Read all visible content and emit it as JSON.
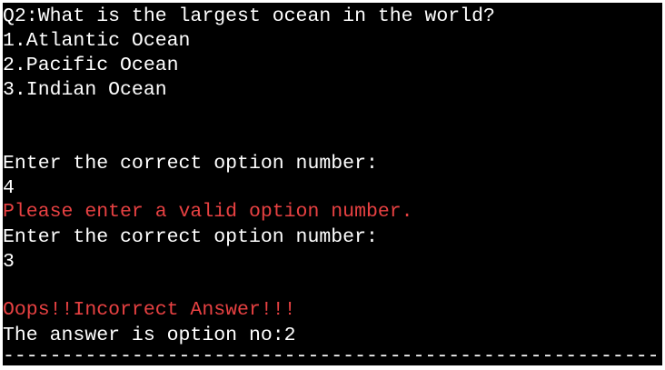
{
  "terminal": {
    "question": "Q2:What is the largest ocean in the world?",
    "options": [
      "1.Atlantic Ocean",
      "2.Pacific Ocean",
      "3.Indian Ocean"
    ],
    "prompt_1": "Enter the correct option number:",
    "input_1": "4",
    "error_message": "Please enter a valid option number.",
    "prompt_2": "Enter the correct option number:",
    "input_2": "3",
    "result_message": "Oops!!Incorrect Answer!!!",
    "answer_line": "The answer is option no:2",
    "separator": "---------------------------------------------------------------------------------------------------"
  },
  "colors": {
    "background": "#000000",
    "text": "#ffffff",
    "error": "#e84142"
  }
}
